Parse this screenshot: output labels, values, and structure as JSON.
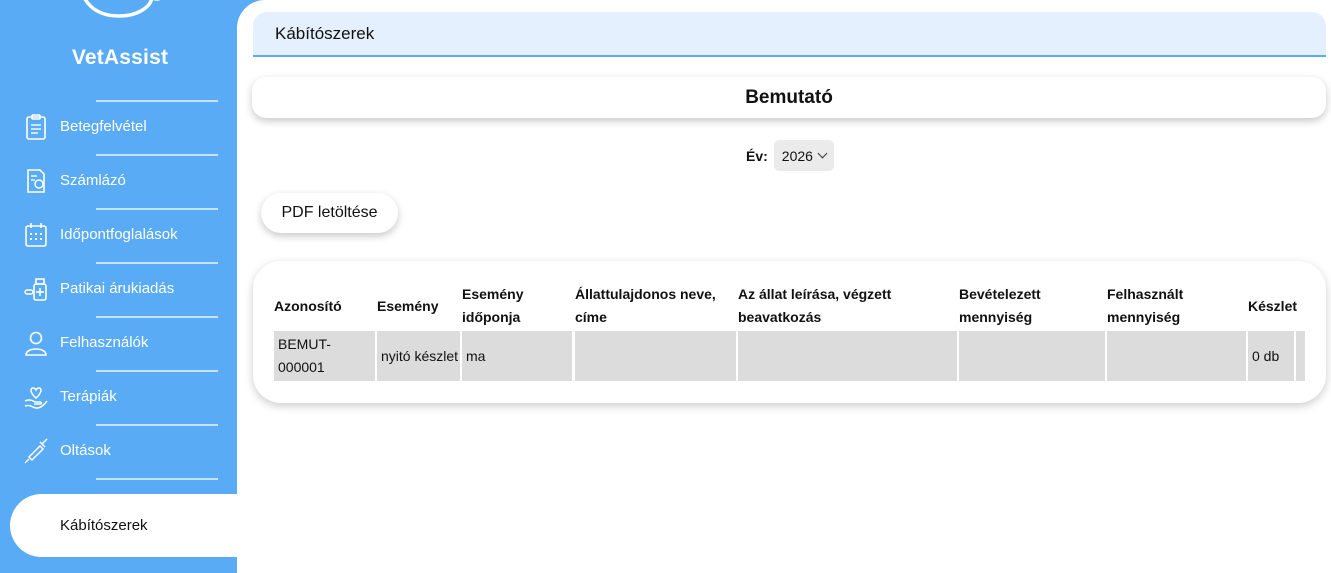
{
  "app": {
    "brand": "VetAssist"
  },
  "sidebar": {
    "items": [
      {
        "label": "Betegfelvétel",
        "icon": "clipboard-icon"
      },
      {
        "label": "Számlázó",
        "icon": "invoice-icon"
      },
      {
        "label": "Időpontfoglalások",
        "icon": "calendar-icon"
      },
      {
        "label": "Patikai árukiadás",
        "icon": "pharmacy-icon"
      },
      {
        "label": "Felhasználók",
        "icon": "user-icon"
      },
      {
        "label": "Terápiák",
        "icon": "hand-heart-icon"
      },
      {
        "label": "Oltások",
        "icon": "syringe-icon"
      },
      {
        "label": "Kábítószerek",
        "icon": "",
        "active": true
      }
    ]
  },
  "page": {
    "title": "Kábítószerek",
    "company": "Bemutató",
    "year_label": "Év:",
    "year_value": "2026",
    "pdf_button": "PDF letöltése"
  },
  "table": {
    "headers": [
      "Azonosító",
      "Esemény",
      "Esemény időponja",
      "Állattulajdonos neve, címe",
      "Az állat leírása, végzett beavatkozás",
      "Bevételezett mennyiség",
      "Felhasznált mennyiség",
      "Készlet"
    ],
    "rows": [
      [
        "BEMUT-000001",
        "nyitó készlet",
        "ma",
        "",
        "",
        "",
        "",
        "0 db"
      ]
    ]
  },
  "colors": {
    "sidebar": "#5aabf5",
    "header_bg": "#e4f0fd",
    "cell_bg": "#dcdcdc"
  }
}
